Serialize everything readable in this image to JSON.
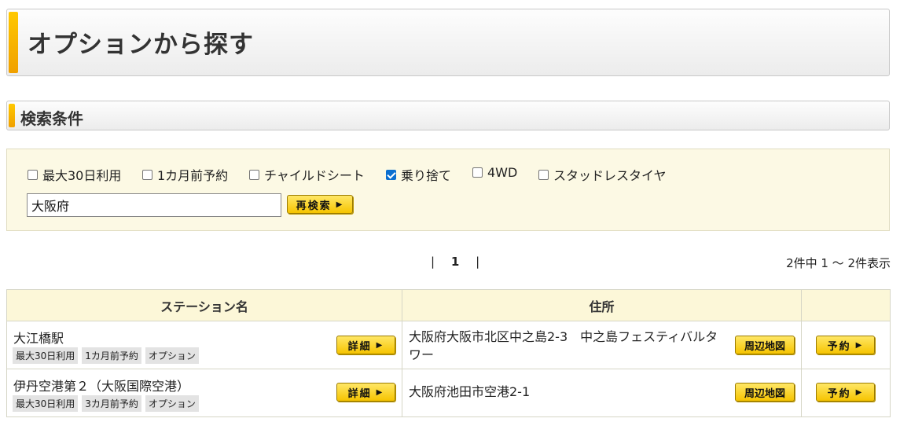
{
  "page": {
    "title": "オプションから探す"
  },
  "conditions": {
    "heading": "検索条件",
    "checkboxes": [
      {
        "label": "最大30日利用",
        "checked": false
      },
      {
        "label": "1カ月前予約",
        "checked": false
      },
      {
        "label": "チャイルドシート",
        "checked": false
      },
      {
        "label": "乗り捨て",
        "checked": true
      },
      {
        "label": "4WD",
        "checked": false
      },
      {
        "label": "スタッドレスタイヤ",
        "checked": false
      }
    ],
    "search_value": "大阪府",
    "research_label": "再検索"
  },
  "pager": {
    "sep": "|",
    "current": "1"
  },
  "result_count": "2件中 1 〜 2件表示",
  "table": {
    "headers": [
      "ステーション名",
      "住所",
      ""
    ],
    "detail_label": "詳細",
    "map_label": "周辺地図",
    "reserve_label": "予約",
    "rows": [
      {
        "station": "大江橋駅",
        "tags": [
          "最大30日利用",
          "1カ月前予約",
          "オプション"
        ],
        "address": "大阪府大阪市北区中之島2-3　中之島フェスティバルタワー"
      },
      {
        "station": "伊丹空港第２（大阪国際空港）",
        "tags": [
          "最大30日利用",
          "3カ月前予約",
          "オプション"
        ],
        "address": "大阪府池田市空港2-1"
      }
    ]
  },
  "colors": {
    "accent": "#f6c400",
    "panel": "#fcf9e4",
    "header_bg": "#fcf7d8",
    "checkbox": "#0b6fd0"
  }
}
